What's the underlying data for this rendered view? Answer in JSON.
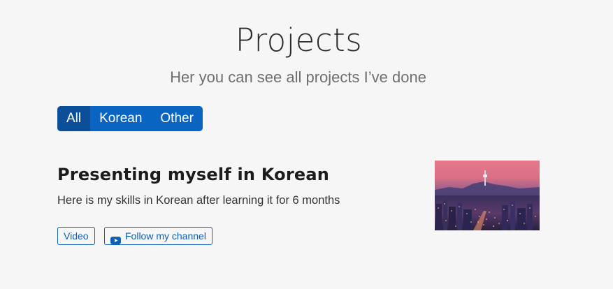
{
  "header": {
    "title": "Projects",
    "subtitle": "Her you can see all projects I’ve done"
  },
  "filters": [
    {
      "label": "All",
      "active": true
    },
    {
      "label": "Korean",
      "active": false
    },
    {
      "label": "Other",
      "active": false
    }
  ],
  "project": {
    "title": "Presenting myself in Korean",
    "description": "Here is my skills in Korean after learning it for 6 months",
    "video_label": "Video",
    "follow_label": "Follow my channel",
    "follow_icon": "youtube-icon",
    "image": "seoul-night-skyline-photo"
  },
  "colors": {
    "accent": "#0a64c2",
    "accent_active": "#0b4f9a",
    "background": "#f6f6f7"
  }
}
